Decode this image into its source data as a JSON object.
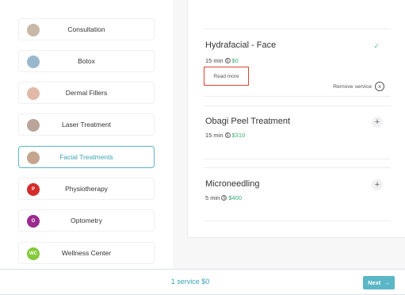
{
  "categories": [
    {
      "label": "Consultation",
      "avatar_type": "photo",
      "avatar_color": "#c9b8a8"
    },
    {
      "label": "Botox",
      "avatar_type": "photo",
      "avatar_color": "#9ab8cc"
    },
    {
      "label": "Dermal Fillers",
      "avatar_type": "photo",
      "avatar_color": "#e2b9a8"
    },
    {
      "label": "Laser Treatment",
      "avatar_type": "photo",
      "avatar_color": "#b9a59a"
    },
    {
      "label": "Facial Treatments",
      "avatar_type": "photo",
      "avatar_color": "#c5a48d",
      "active": true
    },
    {
      "label": "Physiotherapy",
      "avatar_type": "letter",
      "avatar_text": "P",
      "avatar_color": "#d32c2c"
    },
    {
      "label": "Optometry",
      "avatar_type": "letter",
      "avatar_text": "O",
      "avatar_color": "#9b2a8f"
    },
    {
      "label": "Wellness Center",
      "avatar_type": "letter",
      "avatar_text": "WC",
      "avatar_color": "#84c93a"
    }
  ],
  "services": [
    {
      "title": "Hydrafacial - Face",
      "duration": "15 min",
      "price": "$0",
      "selected": true,
      "read_more": "Read more",
      "remove_label": "Remove service"
    },
    {
      "title": "Obagi Peel Treatment",
      "duration": "15 min",
      "price": "$310",
      "selected": false
    },
    {
      "title": "Microneedling",
      "duration": "5 min",
      "price": "$400",
      "selected": false
    }
  ],
  "footer": {
    "summary": "1 service $0",
    "next_label": "Next"
  },
  "colors": {
    "accent": "#5bb6c6",
    "price": "#3aab75",
    "highlight_box": "#d7462f"
  }
}
